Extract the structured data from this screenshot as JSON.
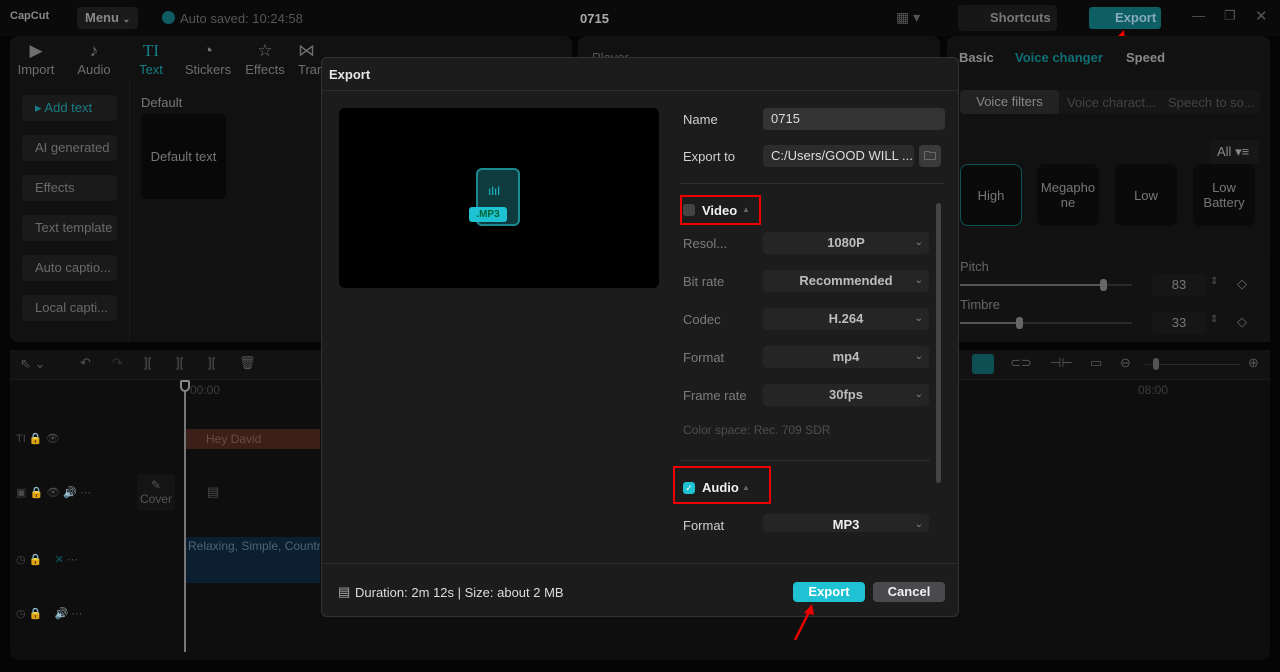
{
  "app": {
    "logo": "CapCut",
    "menu": "Menu",
    "autosave": "Auto saved: 10:24:58",
    "project": "0715",
    "shortcuts": "Shortcuts",
    "export": "Export"
  },
  "toolbar": [
    {
      "label": "Import",
      "icon": "import-icon"
    },
    {
      "label": "Audio",
      "icon": "audio-icon"
    },
    {
      "label": "Text",
      "icon": "text-icon"
    },
    {
      "label": "Stickers",
      "icon": "stickers-icon"
    },
    {
      "label": "Effects",
      "icon": "effects-icon"
    },
    {
      "label": "Tran",
      "icon": "transitions-icon"
    }
  ],
  "sidebar": [
    "Add text",
    "AI generated",
    "Effects",
    "Text template",
    "Auto captio...",
    "Local capti..."
  ],
  "text_panel": {
    "section": "Default",
    "card": "Default text"
  },
  "player": {
    "title": "Player"
  },
  "right_panel": {
    "tabs": [
      "Basic",
      "Voice changer",
      "Speed"
    ],
    "subtabs": [
      "Voice filters",
      "Voice charact...",
      "Speech to so..."
    ],
    "filter": "All",
    "filters": [
      "High",
      "Megapho ne",
      "Low",
      "Low Battery"
    ],
    "pitch_label": "Pitch",
    "pitch": 83,
    "timbre_label": "Timbre",
    "timbre": 33
  },
  "timeline": {
    "start": "00:00",
    "mark": "08:00",
    "text_clip": "Hey David",
    "cover": "Cover",
    "audio_clip": "Relaxing, Simple, Country"
  },
  "export_dialog": {
    "title": "Export",
    "file_badge": ".MP3",
    "name_label": "Name",
    "name_value": "0715",
    "export_to_label": "Export to",
    "export_to_value": "C:/Users/GOOD WILL ...",
    "video": {
      "label": "Video",
      "checked": false,
      "rows": [
        {
          "label": "Resol...",
          "value": "1080P"
        },
        {
          "label": "Bit rate",
          "value": "Recommended"
        },
        {
          "label": "Codec",
          "value": "H.264"
        },
        {
          "label": "Format",
          "value": "mp4"
        },
        {
          "label": "Frame rate",
          "value": "30fps"
        }
      ],
      "color_space": "Color space: Rec. 709 SDR"
    },
    "audio": {
      "label": "Audio",
      "checked": true,
      "format_label": "Format",
      "format_value": "MP3"
    },
    "info": "Duration: 2m 12s | Size: about 2 MB",
    "export_button": "Export",
    "cancel_button": "Cancel"
  },
  "colors": {
    "accent": "#1ec2d2",
    "annotation": "#e00000"
  }
}
